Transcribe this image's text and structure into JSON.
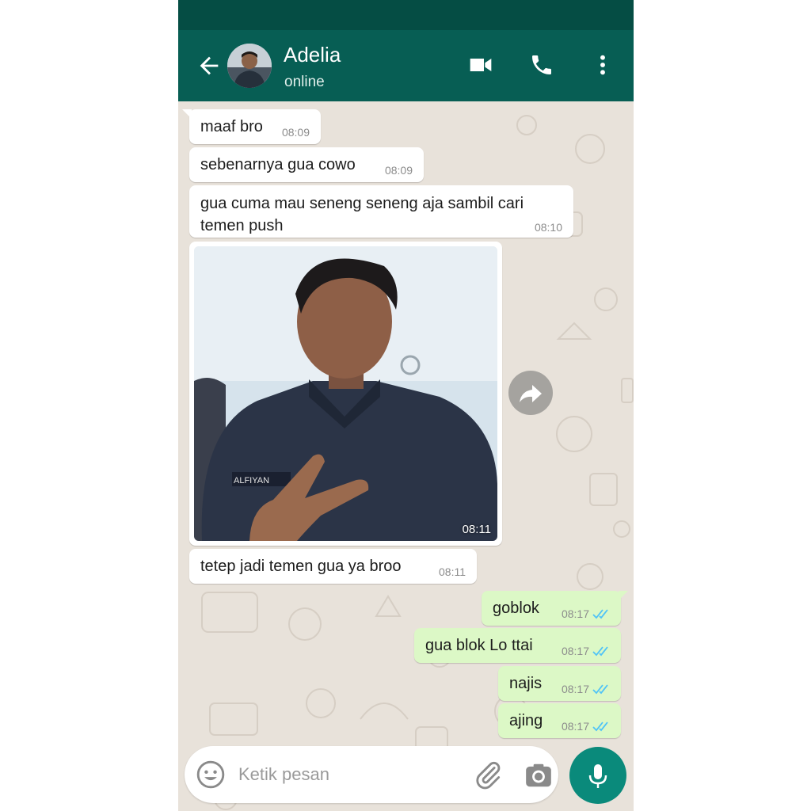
{
  "header": {
    "contact_name": "Adelia",
    "status": "online",
    "back_icon": "arrow-left-icon",
    "video_icon": "video-call-icon",
    "call_icon": "phone-icon",
    "menu_icon": "more-vert-icon"
  },
  "messages": [
    {
      "dir": "in",
      "text": "maaf bro",
      "time": "08:09"
    },
    {
      "dir": "in",
      "text": "sebenarnya gua cowo",
      "time": "08:09"
    },
    {
      "dir": "in",
      "text": "gua cuma mau seneng seneng aja sambil cari temen push",
      "time": "08:10"
    },
    {
      "dir": "in",
      "type": "image",
      "image_text": "ALFIYAN",
      "time": "08:11"
    },
    {
      "dir": "in",
      "text": "tetep jadi temen gua ya broo",
      "time": "08:11"
    },
    {
      "dir": "out",
      "text": "goblok",
      "time": "08:17",
      "status": "read"
    },
    {
      "dir": "out",
      "text": "gua blok Lo ttai",
      "time": "08:17",
      "status": "read"
    },
    {
      "dir": "out",
      "text": "najis",
      "time": "08:17",
      "status": "read"
    },
    {
      "dir": "out",
      "text": "ajing",
      "time": "08:17",
      "status": "read"
    }
  ],
  "composer": {
    "placeholder": "Ketik pesan",
    "emoji_icon": "emoji-icon",
    "attach_icon": "paperclip-icon",
    "camera_icon": "camera-icon",
    "mic_icon": "mic-icon"
  },
  "colors": {
    "header": "#075e54",
    "status_bar": "#054d44",
    "incoming_bubble": "#ffffff",
    "outgoing_bubble": "#dcf8c6",
    "read_ticks": "#4fc3f7",
    "mic_button": "#0a8a7b"
  }
}
